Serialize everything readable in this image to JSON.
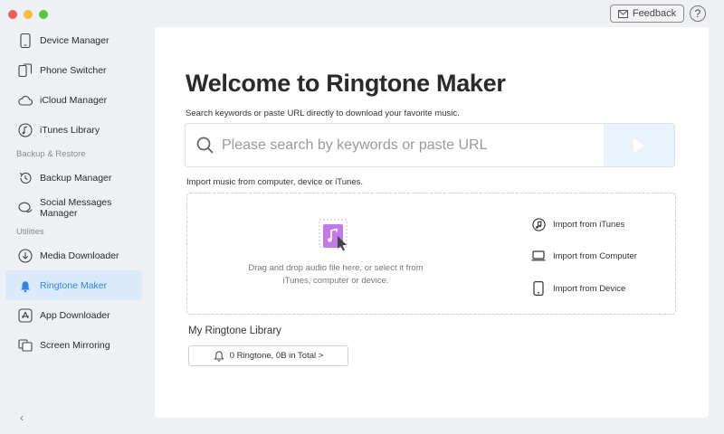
{
  "window": {
    "feedback_label": "Feedback",
    "help_label": "?"
  },
  "sidebar": {
    "items_top": [
      {
        "label": "Device Manager",
        "icon": "phone-icon"
      },
      {
        "label": "Phone Switcher",
        "icon": "phone-switch-icon"
      },
      {
        "label": "iCloud Manager",
        "icon": "cloud-icon"
      },
      {
        "label": "iTunes Library",
        "icon": "music-note-icon"
      }
    ],
    "section_backup": "Backup & Restore",
    "items_backup": [
      {
        "label": "Backup Manager",
        "icon": "history-icon"
      },
      {
        "label": "Social Messages Manager",
        "icon": "chat-bubbles-icon"
      }
    ],
    "section_utilities": "Utilities",
    "items_utilities": [
      {
        "label": "Media Downloader",
        "icon": "download-icon"
      },
      {
        "label": "Ringtone Maker",
        "icon": "bell-icon",
        "active": true
      },
      {
        "label": "App Downloader",
        "icon": "app-store-icon"
      },
      {
        "label": "Screen Mirroring",
        "icon": "screens-icon"
      }
    ],
    "collapse_glyph": "‹"
  },
  "main": {
    "title": "Welcome to Ringtone Maker",
    "subtitle": "Search keywords or paste URL directly to download your favorite music.",
    "search": {
      "placeholder": "Please search by keywords or paste URL",
      "value": ""
    },
    "import_label": "Import music from computer, device or iTunes.",
    "drop_text": "Drag and drop audio file here, or select it from iTunes, computer or device.",
    "import_options": [
      {
        "label": "Import from iTunes",
        "icon": "itunes-icon"
      },
      {
        "label": "Import from Computer",
        "icon": "laptop-icon"
      },
      {
        "label": "Import from Device",
        "icon": "device-icon"
      }
    ],
    "library_title": "My Ringtone Library",
    "library_summary": "0 Ringtone,  0B in Total >"
  },
  "colors": {
    "accent": "#2f86d8",
    "active_bg": "#dbeafb",
    "art_purple": "#c17be6"
  }
}
